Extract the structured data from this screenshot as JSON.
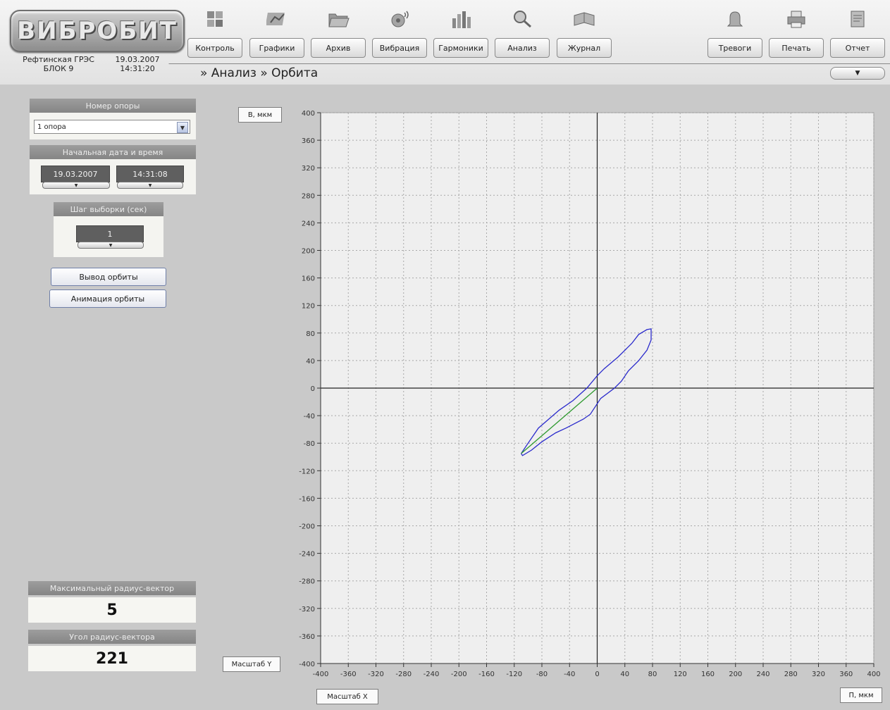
{
  "app": {
    "logo_text": "ВИБРОБИТ",
    "station_line1": "Рефтинская ГРЭС",
    "station_line2": "БЛОК 9",
    "date": "19.03.2007",
    "time": "14:31:20"
  },
  "nav": [
    {
      "label": "Контроль",
      "icon": "monitor-icon"
    },
    {
      "label": "Графики",
      "icon": "charts-icon"
    },
    {
      "label": "Архив",
      "icon": "folder-icon"
    },
    {
      "label": "Вибрация",
      "icon": "vibration-icon"
    },
    {
      "label": "Гармоники",
      "icon": "harmonics-icon"
    },
    {
      "label": "Анализ",
      "icon": "magnifier-icon"
    },
    {
      "label": "Журнал",
      "icon": "book-icon"
    }
  ],
  "nav_right": [
    {
      "label": "Тревоги",
      "icon": "bell-icon"
    },
    {
      "label": "Печать",
      "icon": "printer-icon"
    },
    {
      "label": "Отчет",
      "icon": "report-icon"
    }
  ],
  "breadcrumb": "» Анализ » Орбита",
  "menu_arrow": "▼",
  "left": {
    "support_title": "Номер опоры",
    "support_value": "1 опора",
    "start_title": "Начальная дата и время",
    "start_date": "19.03.2007",
    "start_time": "14:31:08",
    "step_title": "Шаг выборки (сек)",
    "step_value": "1",
    "btn_output": "Вывод орбиты",
    "btn_animation": "Анимация орбиты",
    "max_radius_title": "Максимальный радиус-вектор",
    "max_radius_value": "5",
    "angle_title": "Угол радиус-вектора",
    "angle_value": "221"
  },
  "chart_controls": {
    "ylabel_button": "В, мкм",
    "xlabel_button": "П, мкм",
    "scale_y": "Масштаб Y",
    "scale_x": "Масштаб X"
  },
  "chart_data": {
    "type": "line",
    "xlabel": "П, мкм",
    "ylabel": "В, мкм",
    "xlim": [
      -400,
      400
    ],
    "ylim": [
      -400,
      400
    ],
    "xticks": [
      -400,
      -360,
      -320,
      -280,
      -240,
      -200,
      -160,
      -120,
      -80,
      -40,
      0,
      40,
      80,
      120,
      160,
      200,
      240,
      280,
      320,
      360,
      400
    ],
    "yticks": [
      400,
      360,
      320,
      280,
      240,
      200,
      160,
      120,
      80,
      40,
      0,
      -40,
      -80,
      -120,
      -160,
      -200,
      -240,
      -280,
      -320,
      -360,
      -400
    ],
    "grid": true,
    "series": [
      {
        "color": "#2a2acc",
        "points": [
          [
            -110,
            -95
          ],
          [
            -100,
            -80
          ],
          [
            -85,
            -58
          ],
          [
            -70,
            -45
          ],
          [
            -55,
            -32
          ],
          [
            -35,
            -18
          ],
          [
            -15,
            0
          ],
          [
            0,
            18
          ],
          [
            10,
            28
          ],
          [
            30,
            45
          ],
          [
            50,
            65
          ],
          [
            60,
            78
          ],
          [
            72,
            85
          ],
          [
            78,
            86
          ],
          [
            78,
            70
          ],
          [
            72,
            55
          ],
          [
            60,
            40
          ],
          [
            45,
            25
          ],
          [
            35,
            10
          ],
          [
            25,
            0
          ],
          [
            5,
            -15
          ],
          [
            -10,
            -38
          ],
          [
            -20,
            -45
          ],
          [
            -45,
            -58
          ],
          [
            -60,
            -65
          ],
          [
            -80,
            -78
          ],
          [
            -95,
            -90
          ],
          [
            -108,
            -98
          ],
          [
            -110,
            -95
          ]
        ]
      },
      {
        "color": "#2e9a2e",
        "points": [
          [
            -110,
            -95
          ],
          [
            0,
            0
          ]
        ]
      }
    ]
  }
}
